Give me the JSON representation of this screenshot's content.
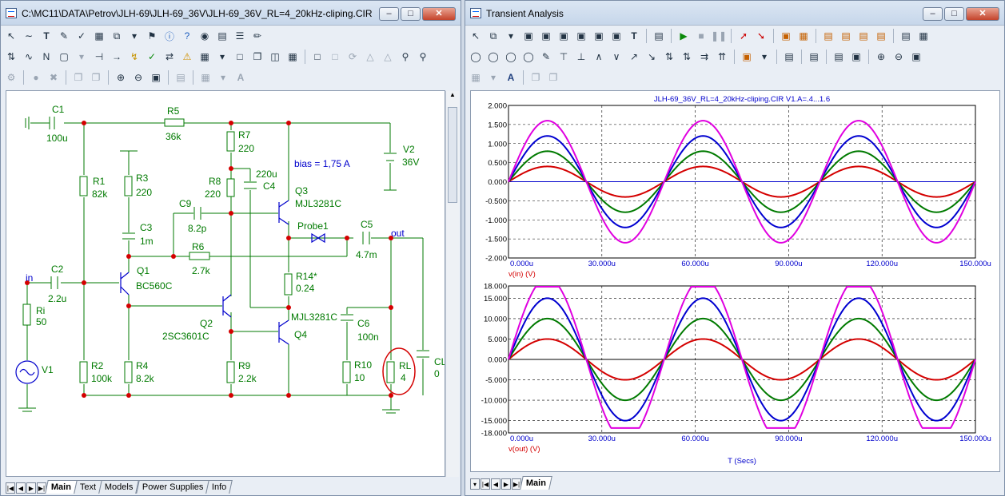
{
  "schematic_window": {
    "title": "C:\\MC11\\DATA\\Petrov\\JLH-69\\JLH-69_36V\\JLH-69_36V_RL=4_20kHz-cliping.CIR",
    "tabs": [
      "Main",
      "Text",
      "Models",
      "Power Supplies",
      "Info"
    ],
    "active_tab": "Main",
    "annotation": "bias = 1,75 A",
    "nodes": {
      "in": "in",
      "out": "out"
    },
    "probe": "Probe1",
    "components": [
      {
        "ref": "C1",
        "value": "100u"
      },
      {
        "ref": "R5",
        "value": "36k"
      },
      {
        "ref": "R7",
        "value": "220"
      },
      {
        "ref": "V2",
        "value": "36V"
      },
      {
        "ref": "R1",
        "value": "82k"
      },
      {
        "ref": "R3",
        "value": "220"
      },
      {
        "ref": "R8",
        "value": "220"
      },
      {
        "ref": "C4",
        "value": "220u"
      },
      {
        "ref": "Q3",
        "value": "MJL3281C"
      },
      {
        "ref": "C9",
        "value": "8.2p"
      },
      {
        "ref": "C3",
        "value": "1m"
      },
      {
        "ref": "C5",
        "value": "4.7m"
      },
      {
        "ref": "R6",
        "value": "2.7k"
      },
      {
        "ref": "C2",
        "value": "2.2u"
      },
      {
        "ref": "Q1",
        "value": "BC560C"
      },
      {
        "ref": "R14*",
        "value": "0.24"
      },
      {
        "ref": "Ri",
        "value": "50"
      },
      {
        "ref": "Q2",
        "value": "2SC3601C"
      },
      {
        "ref": "Q4",
        "value": "MJL3281C"
      },
      {
        "ref": "C6",
        "value": "100n"
      },
      {
        "ref": "V1",
        "value": ""
      },
      {
        "ref": "R2",
        "value": "100k"
      },
      {
        "ref": "R4",
        "value": "8.2k"
      },
      {
        "ref": "R9",
        "value": "2.2k"
      },
      {
        "ref": "R10",
        "value": "10"
      },
      {
        "ref": "RL",
        "value": "4"
      },
      {
        "ref": "CL",
        "value": "0"
      }
    ]
  },
  "analysis_window": {
    "title": "Transient Analysis",
    "tabs": [
      "Main"
    ],
    "active_tab": "Main",
    "plot_title": "JLH-69_36V_RL=4_20kHz-cliping.CIR V1.A=.4...1.6",
    "x_axis_label": "T (Secs)"
  },
  "chart_data": [
    {
      "type": "line",
      "ylabel": "v(in) (V)",
      "xlim": [
        0,
        150
      ],
      "ylim": [
        -2,
        2
      ],
      "x_ticks": [
        "0.000u",
        "30.000u",
        "60.000u",
        "90.000u",
        "120.000u",
        "150.000u"
      ],
      "y_ticks": [
        "2.000",
        "1.500",
        "1.000",
        "0.500",
        "0.000",
        "-0.500",
        "-1.000",
        "-1.500",
        "-2.000"
      ],
      "grid": true,
      "frequency_hz": 20000,
      "series": [
        {
          "amplitude": 0.4,
          "color": "#d40000"
        },
        {
          "amplitude": 0.8,
          "color": "#007a00"
        },
        {
          "amplitude": 1.2,
          "color": "#0000d0"
        },
        {
          "amplitude": 1.6,
          "color": "#e000e0"
        }
      ]
    },
    {
      "type": "line",
      "ylabel": "v(out) (V)",
      "xlim": [
        0,
        150
      ],
      "ylim": [
        -18,
        18
      ],
      "x_ticks": [
        "0.000u",
        "30.000u",
        "60.000u",
        "90.000u",
        "120.000u",
        "150.000u"
      ],
      "y_ticks": [
        "18.000",
        "15.000",
        "10.000",
        "5.000",
        "0.000",
        "-5.000",
        "-10.000",
        "-15.000",
        "-18.000"
      ],
      "grid": true,
      "frequency_hz": 20000,
      "series": [
        {
          "amplitude": 5,
          "color": "#d40000"
        },
        {
          "amplitude": 10,
          "color": "#007a00"
        },
        {
          "amplitude": 15,
          "color": "#0000d0"
        },
        {
          "amplitude": 20,
          "clip_high": 17.8,
          "clip_low": -16.8,
          "color": "#e000e0"
        }
      ]
    }
  ]
}
